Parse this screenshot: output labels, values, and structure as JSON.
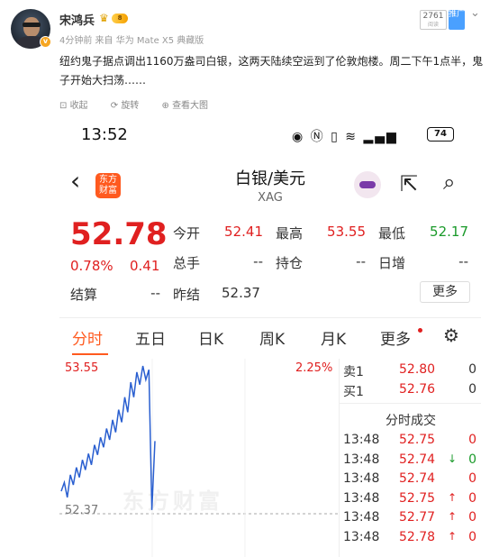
{
  "post": {
    "username": "宋鸿兵",
    "vip_level": "8",
    "meta": "4分钟前  来自 华为 Mate X5 典藏版",
    "views": "2761",
    "views_label": "阅读",
    "fire_tab": "推广",
    "text": "纽约鬼子据点调出1160万盎司白银，这两天陆续空运到了伦敦炮楼。周二下午1点半，鬼子开始大扫荡……",
    "actions": {
      "collect": "收起",
      "rotate": "旋转",
      "view_large": "查看大图"
    }
  },
  "phone": {
    "clock": "13:52",
    "battery": "74",
    "app_logo": "东方财富",
    "stock_name": "白银/美元",
    "stock_code": "XAG",
    "quote": {
      "price": "52.78",
      "change_pct": "0.78%",
      "change_abs": "0.41",
      "open_label": "今开",
      "open": "52.41",
      "high_label": "最高",
      "high": "53.55",
      "low_label": "最低",
      "low": "52.17",
      "volume_label": "总手",
      "volume": "--",
      "oi_label": "持仓",
      "oi": "--",
      "daily_inc_label": "日增",
      "daily_inc": "--",
      "settle_label": "结算",
      "settle": "--",
      "prev_settle_label": "昨结",
      "prev_settle": "52.37",
      "more": "更多"
    },
    "tabs": [
      "分时",
      "五日",
      "日K",
      "周K",
      "月K",
      "更多"
    ],
    "chart_labels": {
      "high": "53.55",
      "pct": "2.25%",
      "base": "52.37",
      "watermark": "东方财富"
    },
    "orderbook": {
      "ask": {
        "label": "卖1",
        "price": "52.80",
        "vol": "0"
      },
      "bid": {
        "label": "买1",
        "price": "52.76",
        "vol": "0"
      }
    },
    "ticks_title": "分时成交",
    "ticks": [
      {
        "time": "13:48",
        "price": "52.75",
        "arrow": "",
        "vol": "0",
        "vol_color": "red"
      },
      {
        "time": "13:48",
        "price": "52.74",
        "arrow": "↓",
        "vol": "0",
        "vol_color": "green"
      },
      {
        "time": "13:48",
        "price": "52.74",
        "arrow": "",
        "vol": "0",
        "vol_color": "red"
      },
      {
        "time": "13:48",
        "price": "52.75",
        "arrow": "↑",
        "vol": "0",
        "vol_color": "red"
      },
      {
        "time": "13:48",
        "price": "52.77",
        "arrow": "↑",
        "vol": "0",
        "vol_color": "red"
      },
      {
        "time": "13:48",
        "price": "52.78",
        "arrow": "↑",
        "vol": "0",
        "vol_color": "red"
      }
    ]
  },
  "chart_data": {
    "type": "line",
    "ylim": [
      52.37,
      53.55
    ],
    "series": [
      {
        "values": [
          52.55,
          52.62,
          52.5,
          52.68,
          52.6,
          52.74,
          52.66,
          52.8,
          52.72,
          52.85,
          52.76,
          52.92,
          52.84,
          52.98,
          52.9,
          53.05,
          52.96,
          53.12,
          53.02,
          53.2,
          53.1,
          53.3,
          53.18,
          53.42,
          53.3,
          53.5,
          53.4,
          53.55,
          53.44,
          53.52,
          52.4,
          52.95
        ]
      }
    ]
  }
}
